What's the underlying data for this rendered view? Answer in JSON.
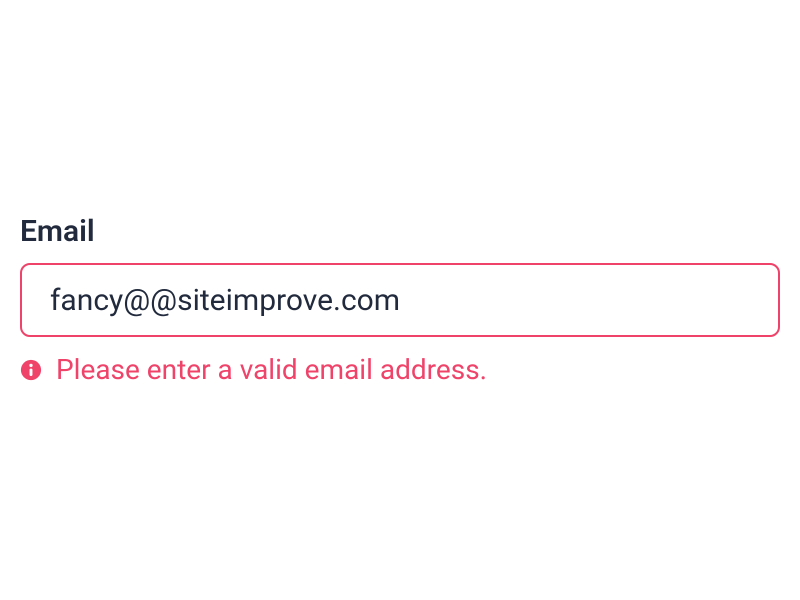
{
  "form": {
    "email": {
      "label": "Email",
      "value": "fancy@@siteimprove.com",
      "error_message": "Please enter a valid email address."
    }
  },
  "colors": {
    "error": "#ef436a",
    "text": "#222b3d"
  }
}
